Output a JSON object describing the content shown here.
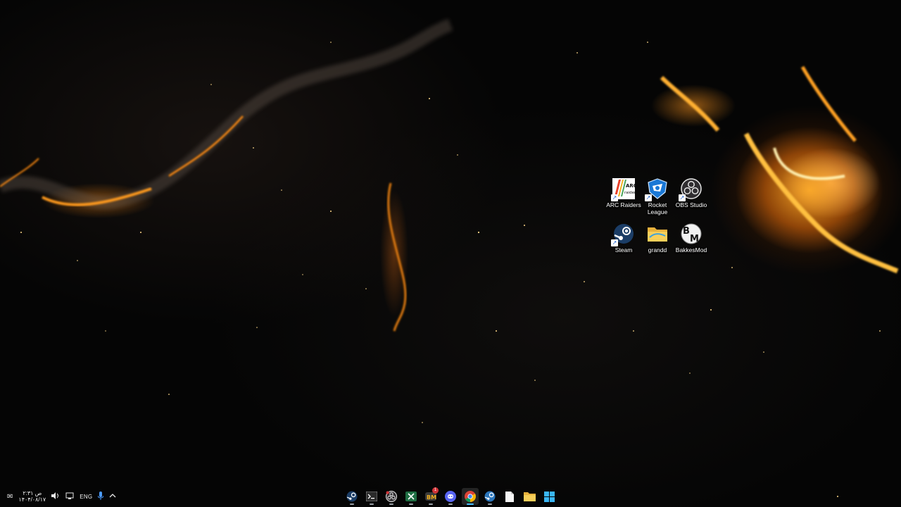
{
  "desktop": {
    "icons": [
      {
        "label": "ARC Raiders",
        "icon": "arc-raiders-icon",
        "shortcut": true
      },
      {
        "label": "Rocket League",
        "icon": "rocket-league-icon",
        "shortcut": true
      },
      {
        "label": "OBS Studio",
        "icon": "obs-studio-icon",
        "shortcut": true
      },
      {
        "label": "Steam",
        "icon": "steam-icon",
        "shortcut": true
      },
      {
        "label": "grandd",
        "icon": "folder-icon",
        "shortcut": false
      },
      {
        "label": "BakkesMod",
        "icon": "bakkesmod-icon",
        "shortcut": false
      }
    ]
  },
  "taskbar": {
    "tray": {
      "clock_time": "۲:۳۱ ص",
      "clock_date": "۱۴۰۴/۰۸/۱۷",
      "language": "ENG",
      "icons": [
        "notification-icon",
        "network-icon",
        "volume-icon",
        "mic-icon",
        "show-hidden-icons-chevron"
      ]
    },
    "apps": [
      {
        "name": "steam",
        "icon": "steam-icon",
        "running": true
      },
      {
        "name": "terminal",
        "icon": "terminal-icon",
        "running": true
      },
      {
        "name": "obs-studio",
        "icon": "obs-studio-icon",
        "running": true
      },
      {
        "name": "excel",
        "icon": "excel-icon",
        "running": true
      },
      {
        "name": "bakkesmod",
        "icon": "bakkesmod-icon",
        "running": true,
        "badge": "1"
      },
      {
        "name": "discord",
        "icon": "discord-icon",
        "running": true
      },
      {
        "name": "chrome",
        "icon": "chrome-icon",
        "running": true,
        "active": true
      },
      {
        "name": "steam-2",
        "icon": "steam-icon",
        "running": true
      },
      {
        "name": "notepad",
        "icon": "file-icon",
        "running": false
      },
      {
        "name": "file-explorer",
        "icon": "folder-icon",
        "running": false
      },
      {
        "name": "start",
        "icon": "windows-start-icon",
        "running": false
      }
    ]
  },
  "colors": {
    "accent": "#4cc2ff",
    "nebula_orange": "#ff9a1f",
    "background": "#050505"
  }
}
